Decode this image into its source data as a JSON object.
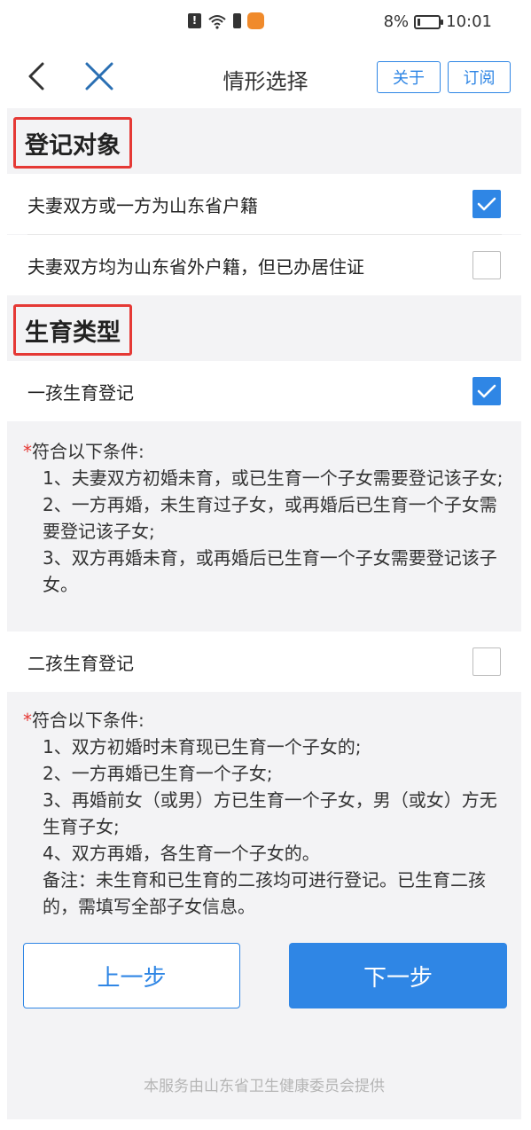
{
  "status_bar": {
    "alert_icon": "alert-icon",
    "wifi_icon": "wifi-icon",
    "battery_percent": "8%",
    "time": "10:01"
  },
  "nav": {
    "title": "情形选择",
    "about_label": "关于",
    "subscribe_label": "订阅"
  },
  "sections": {
    "registration_target": {
      "title": "登记对象",
      "options": [
        {
          "label": "夫妻双方或一方为山东省户籍",
          "checked": true
        },
        {
          "label": "夫妻双方均为山东省外户籍，但已办居住证",
          "checked": false
        }
      ]
    },
    "birth_type": {
      "title": "生育类型",
      "first_child": {
        "label": "一孩生育登记",
        "checked": true,
        "conditions_intro": "符合以下条件:",
        "conditions": [
          "1、夫妻双方初婚未育，或已生育一个子女需要登记该子女;",
          "2、一方再婚，未生育过子女，或再婚后已生育一个子女需要登记该子女;",
          "3、双方再婚未育，或再婚后已生育一个子女需要登记该子女。"
        ]
      },
      "second_child": {
        "label": "二孩生育登记",
        "checked": false,
        "conditions_intro": "符合以下条件:",
        "conditions": [
          "1、双方初婚时未育现已生育一个子女的;",
          "2、一方再婚已生育一个子女;",
          "3、再婚前女（或男）方已生育一个子女，男（或女）方无生育子女;",
          "4、双方再婚，各生育一个子女的。",
          "备注：未生育和已生育的二孩均可进行登记。已生育二孩的，需填写全部子女信息。"
        ]
      }
    }
  },
  "buttons": {
    "prev_label": "上一步",
    "next_label": "下一步"
  },
  "footer": "本服务由山东省卫生健康委员会提供",
  "colors": {
    "accent": "#2f86e5",
    "highlight_border": "#e53935",
    "background": "#f3f3f5"
  }
}
